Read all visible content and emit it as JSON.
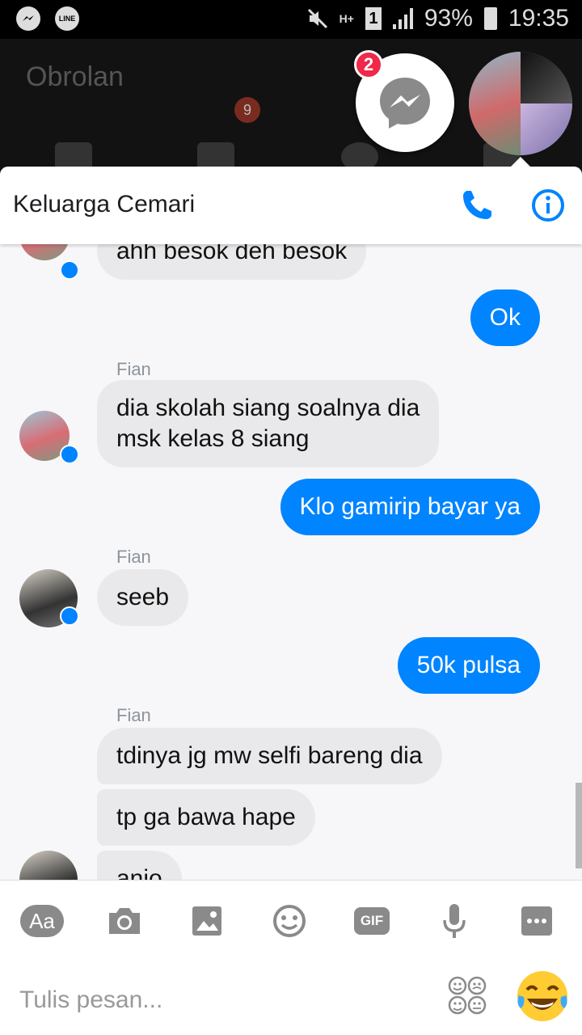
{
  "status_bar": {
    "battery": "93%",
    "time": "19:35",
    "line_label": "LINE",
    "network": "H+",
    "sim": "1"
  },
  "background_app": {
    "title": "Obrolan",
    "tab_badge": "9"
  },
  "chat_heads": {
    "unread_badge": "2"
  },
  "chat": {
    "title": "Keluarga Cemari",
    "messages": [
      {
        "text": "ahh besok deh besok"
      },
      {
        "text": "Ok"
      },
      {
        "sender": "Fian"
      },
      {
        "line1": "dia skolah siang soalnya dia",
        "line2": "msk kelas 8 siang"
      },
      {
        "text": "Klo gamirip bayar ya"
      },
      {
        "sender": "Fian"
      },
      {
        "text": "seeb"
      },
      {
        "text": "50k pulsa"
      },
      {
        "sender": "Fian"
      },
      {
        "text": "tdinya jg mw selfi bareng dia"
      },
      {
        "text": "tp ga bawa hape"
      },
      {
        "text": "anjo"
      }
    ]
  },
  "composer": {
    "placeholder": "Tulis pesan...",
    "aa_label": "Aa",
    "gif_label": "GIF"
  },
  "colors": {
    "accent": "#0084ff",
    "incoming_bubble": "#e9e9eb",
    "badge": "#f02849"
  }
}
